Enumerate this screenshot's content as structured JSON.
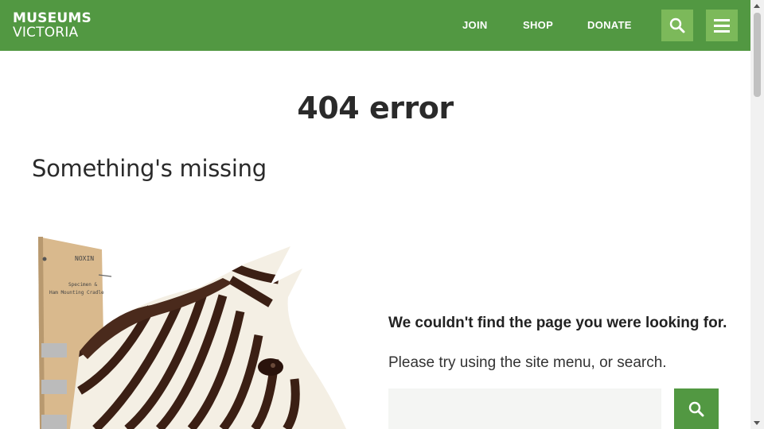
{
  "header": {
    "logo_line1": "MUSEUMS",
    "logo_line2": "VICTORIA",
    "nav": [
      {
        "label": "JOIN"
      },
      {
        "label": "SHOP"
      },
      {
        "label": "DONATE"
      }
    ],
    "search_icon": "search-icon",
    "menu_icon": "hamburger-menu-icon"
  },
  "main": {
    "error_title": "404 error",
    "heading": "Something's missing",
    "message": "We couldn't find the page you were looking for.",
    "submessage": "Please try using the site menu, or search.",
    "search": {
      "placeholder": "",
      "button_icon": "search-icon"
    },
    "image": {
      "label_line1": "NOXIN",
      "label_line2": "Specimen &",
      "label_line3": "Ham Mounting Cradle"
    }
  },
  "colors": {
    "brand_green": "#529842",
    "button_light_green": "#7cb95a",
    "text_dark": "#2a2a2a",
    "input_bg": "#f4f5f3"
  }
}
